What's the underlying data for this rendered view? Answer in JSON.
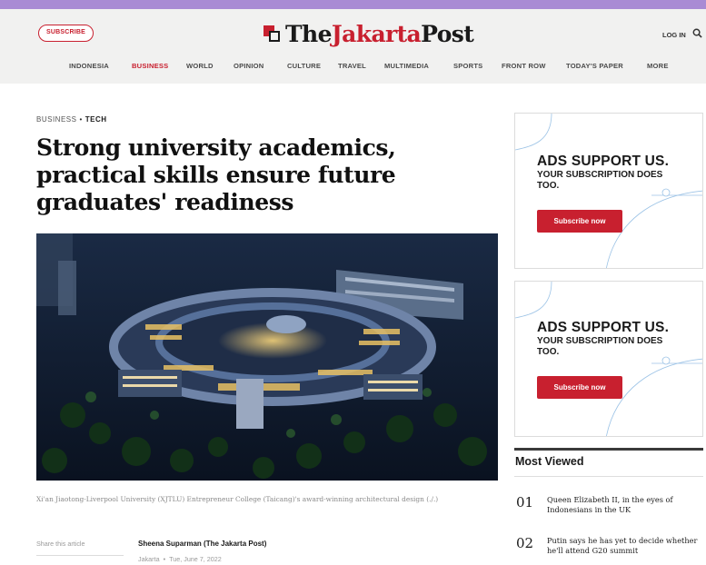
{
  "header": {
    "subscribe_label": "SUBSCRIBE",
    "logo": {
      "the": "The",
      "jakarta": "Jakarta",
      "post": "Post"
    },
    "login_label": "LOG IN",
    "nav": [
      {
        "label": "INDONESIA",
        "active": false
      },
      {
        "label": "BUSINESS",
        "active": true
      },
      {
        "label": "WORLD",
        "active": false
      },
      {
        "label": "OPINION",
        "active": false
      },
      {
        "label": "CULTURE",
        "active": false
      },
      {
        "label": "TRAVEL",
        "active": false
      },
      {
        "label": "MULTIMEDIA",
        "active": false
      },
      {
        "label": "SPORTS",
        "active": false
      },
      {
        "label": "FRONT ROW",
        "active": false
      },
      {
        "label": "TODAY'S PAPER",
        "active": false
      },
      {
        "label": "MORE",
        "active": false
      }
    ]
  },
  "article": {
    "section": "BUSINESS",
    "subsection": "TECH",
    "separator": "•",
    "headline": "Strong university academics, practical skills ensure future graduates' readiness",
    "caption": "Xi'an Jiaotong-Liverpool University (XJTLU) Entrepreneur College (Taicang)'s award-winning architectural design (./.)",
    "share_label": "Share this article",
    "author": "Sheena Suparman (The Jakarta Post)",
    "location": "Jakarta",
    "date": "Tue, June 7, 2022"
  },
  "ads": [
    {
      "title": "ADS SUPPORT US.",
      "subtitle": "YOUR SUBSCRIPTION DOES TOO.",
      "button": "Subscribe now"
    },
    {
      "title": "ADS SUPPORT US.",
      "subtitle": "YOUR SUBSCRIPTION DOES TOO.",
      "button": "Subscribe now"
    }
  ],
  "most_viewed": {
    "title": "Most Viewed",
    "items": [
      {
        "num": "01",
        "text": "Queen Elizabeth II, in the eyes of Indonesians in the UK"
      },
      {
        "num": "02",
        "text": "Putin says he has yet to decide whether he'll attend G20 summit"
      }
    ]
  },
  "colors": {
    "brand_red": "#c8202f",
    "top_bar": "#a98bd4",
    "header_bg": "#f1f1f0"
  }
}
